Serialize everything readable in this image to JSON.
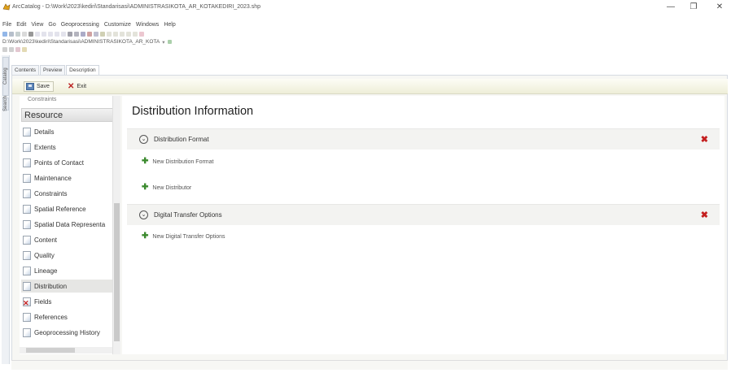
{
  "window": {
    "title": "ArcCatalog - D:\\Work\\2023\\kediri\\Standarisasi\\ADMINISTRASIKOTA_AR_KOTAKEDIRI_2023.shp",
    "minimize_glyph": "—",
    "maximize_glyph": "❐",
    "close_glyph": "✕"
  },
  "menu": [
    "File",
    "Edit",
    "View",
    "Go",
    "Geoprocessing",
    "Customize",
    "Windows",
    "Help"
  ],
  "location": {
    "path": "D:\\Work\\2023\\kediri\\Standarisasi\\ADMINISTRASIKOTA_AR_KOTA"
  },
  "left_strip": {
    "tabs": [
      "Catalog",
      "Search"
    ]
  },
  "tabs": [
    "Contents",
    "Preview",
    "Description"
  ],
  "edit_toolbar": {
    "save_label": "Save",
    "exit_label": "Exit"
  },
  "sidebar": {
    "clipped_item": "Constraints",
    "header": "Resource",
    "items": [
      {
        "label": "Details",
        "icon": "document-icon"
      },
      {
        "label": "Extents",
        "icon": "document-icon"
      },
      {
        "label": "Points of Contact",
        "icon": "document-icon"
      },
      {
        "label": "Maintenance",
        "icon": "document-icon"
      },
      {
        "label": "Constraints",
        "icon": "document-icon"
      },
      {
        "label": "Spatial Reference",
        "icon": "document-icon"
      },
      {
        "label": "Spatial Data Representa",
        "icon": "document-icon"
      },
      {
        "label": "Content",
        "icon": "document-icon"
      },
      {
        "label": "Quality",
        "icon": "document-icon"
      },
      {
        "label": "Lineage",
        "icon": "document-icon"
      },
      {
        "label": "Distribution",
        "icon": "document-icon",
        "selected": true
      },
      {
        "label": "Fields",
        "icon": "error-document-icon"
      },
      {
        "label": "References",
        "icon": "document-icon"
      },
      {
        "label": "Geoprocessing History",
        "icon": "document-icon"
      }
    ]
  },
  "content": {
    "title": "Distribution Information",
    "sections": [
      {
        "label": "Distribution Format",
        "add_label": "New Distribution Format"
      },
      {
        "label": "Digital Transfer Options",
        "add_label": "New Digital Transfer Options"
      }
    ],
    "new_distributor_label": "New Distributor",
    "remove_glyph": "✖",
    "add_glyph": "✚",
    "expand_glyph": "⌄"
  },
  "colors": {
    "accent_red": "#c41f1f",
    "add_green": "#3b8a2e",
    "toolbar_bg": "#eeeed8"
  }
}
